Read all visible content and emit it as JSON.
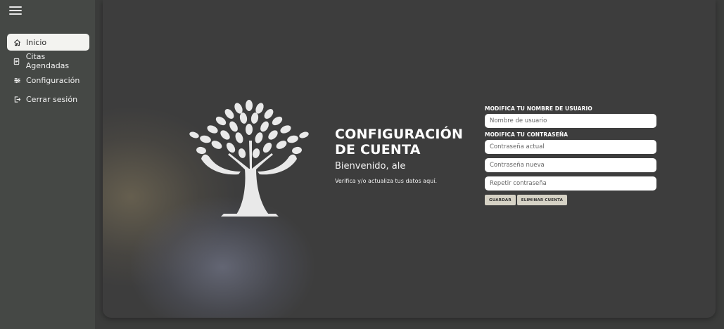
{
  "sidebar": {
    "items": [
      {
        "label": "Inicio",
        "icon": "home-icon",
        "active": true
      },
      {
        "label": "Citas Agendadas",
        "icon": "document-icon",
        "active": false
      },
      {
        "label": "Configuración",
        "icon": "sliders-icon",
        "active": false
      },
      {
        "label": "Cerrar sesión",
        "icon": "logout-icon",
        "active": false
      }
    ]
  },
  "main": {
    "title_line1": "CONFIGURACIÓN",
    "title_line2": "DE CUENTA",
    "welcome": "Bienvenido, ale",
    "subtext": "Verifica y/o actualiza tus datos aquí.",
    "logo_icon": "tree-hands-logo"
  },
  "form": {
    "username_label": "MODIFICA TU NOMBRE DE USUARIO",
    "username_placeholder": "Nombre de usuario",
    "password_label": "MODIFICA TU CONTRASEÑA",
    "current_password_placeholder": "Contraseña actual",
    "new_password_placeholder": "Contraseña nueva",
    "repeat_password_placeholder": "Repetir contraseña",
    "save_label": "GUARDAR",
    "delete_label": "ELIMINAR CUENTA"
  },
  "colors": {
    "sidebar_bg": "#454845",
    "card_bg": "#3d3d3d",
    "page_bg": "#3b3c3b",
    "active_item_bg": "#f3f3f0",
    "button_bg": "#d6d2c5"
  }
}
